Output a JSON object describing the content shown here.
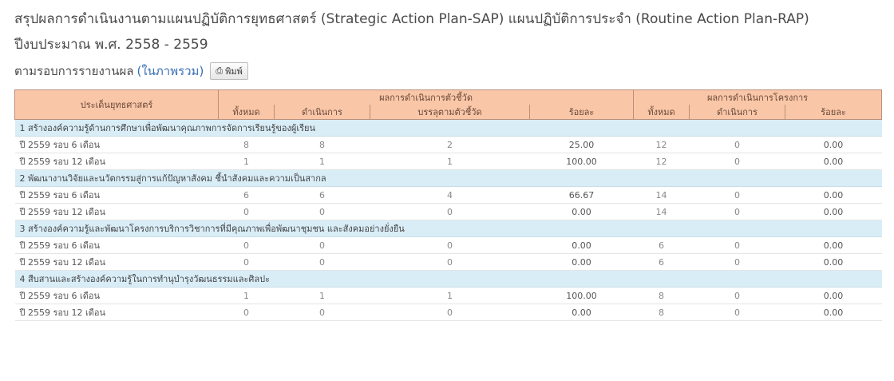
{
  "page": {
    "title": "สรุปผลการดำเนินงานตามแผนปฏิบัติการยุทธศาสตร์ (Strategic Action Plan-SAP) แผนปฏิบัติการประจำ (Routine Action Plan-RAP) ปีงบประมาณ พ.ศ. 2558 - 2559",
    "subtitle": "ตามรอบการรายงานผล",
    "subtitle_link": "(ในภาพรวม)",
    "print_label": "พิมพ์"
  },
  "table": {
    "header": {
      "strategy": "ประเด็นยุทธศาสตร์",
      "kpi_group": "ผลการดำเนินการตัวชี้วัด",
      "project_group": "ผลการดำเนินการโครงการ",
      "kpi_cols": [
        "ทั้งหมด",
        "ดำเนินการ",
        "บรรลุตามตัวชี้วัด",
        "ร้อยละ"
      ],
      "project_cols": [
        "ทั้งหมด",
        "ดำเนินการ",
        "ร้อยละ"
      ]
    },
    "groups": [
      {
        "title": "1 สร้างองค์ความรู้ด้านการศึกษาเพื่อพัฒนาคุณภาพการจัดการเรียนรู้ของผู้เรียน",
        "rows": [
          {
            "label": "ปี 2559 รอบ 6 เดือน",
            "total": "8",
            "done": "8",
            "achieved": "2",
            "pct": "25.00",
            "p_total": "12",
            "p_done": "0",
            "p_pct": "0.00"
          },
          {
            "label": "ปี 2559 รอบ 12 เดือน",
            "total": "1",
            "done": "1",
            "achieved": "1",
            "pct": "100.00",
            "p_total": "12",
            "p_done": "0",
            "p_pct": "0.00"
          }
        ]
      },
      {
        "title": "2 พัฒนางานวิจัยและนวัตกรรมสู่การแก้ปัญหาสังคม ชี้นำสังคมและความเป็นสากล",
        "rows": [
          {
            "label": "ปี 2559 รอบ 6 เดือน",
            "total": "6",
            "done": "6",
            "achieved": "4",
            "pct": "66.67",
            "p_total": "14",
            "p_done": "0",
            "p_pct": "0.00"
          },
          {
            "label": "ปี 2559 รอบ 12 เดือน",
            "total": "0",
            "done": "0",
            "achieved": "0",
            "pct": "0.00",
            "p_total": "14",
            "p_done": "0",
            "p_pct": "0.00"
          }
        ]
      },
      {
        "title": "3 สร้างองค์ความรู้และพัฒนาโครงการบริการวิชาการที่มีคุณภาพเพื่อพัฒนาชุมชน และสังคมอย่างยั่งยืน",
        "rows": [
          {
            "label": "ปี 2559 รอบ 6 เดือน",
            "total": "0",
            "done": "0",
            "achieved": "0",
            "pct": "0.00",
            "p_total": "6",
            "p_done": "0",
            "p_pct": "0.00"
          },
          {
            "label": "ปี 2559 รอบ 12 เดือน",
            "total": "0",
            "done": "0",
            "achieved": "0",
            "pct": "0.00",
            "p_total": "6",
            "p_done": "0",
            "p_pct": "0.00"
          }
        ]
      },
      {
        "title": "4 สืบสานและสร้างองค์ความรู้ในการทำนุบำรุงวัฒนธรรมและศิลปะ",
        "rows": [
          {
            "label": "ปี 2559 รอบ 6 เดือน",
            "total": "1",
            "done": "1",
            "achieved": "1",
            "pct": "100.00",
            "p_total": "8",
            "p_done": "0",
            "p_pct": "0.00"
          },
          {
            "label": "ปี 2559 รอบ 12 เดือน",
            "total": "0",
            "done": "0",
            "achieved": "0",
            "pct": "0.00",
            "p_total": "8",
            "p_done": "0",
            "p_pct": "0.00"
          }
        ]
      }
    ]
  }
}
